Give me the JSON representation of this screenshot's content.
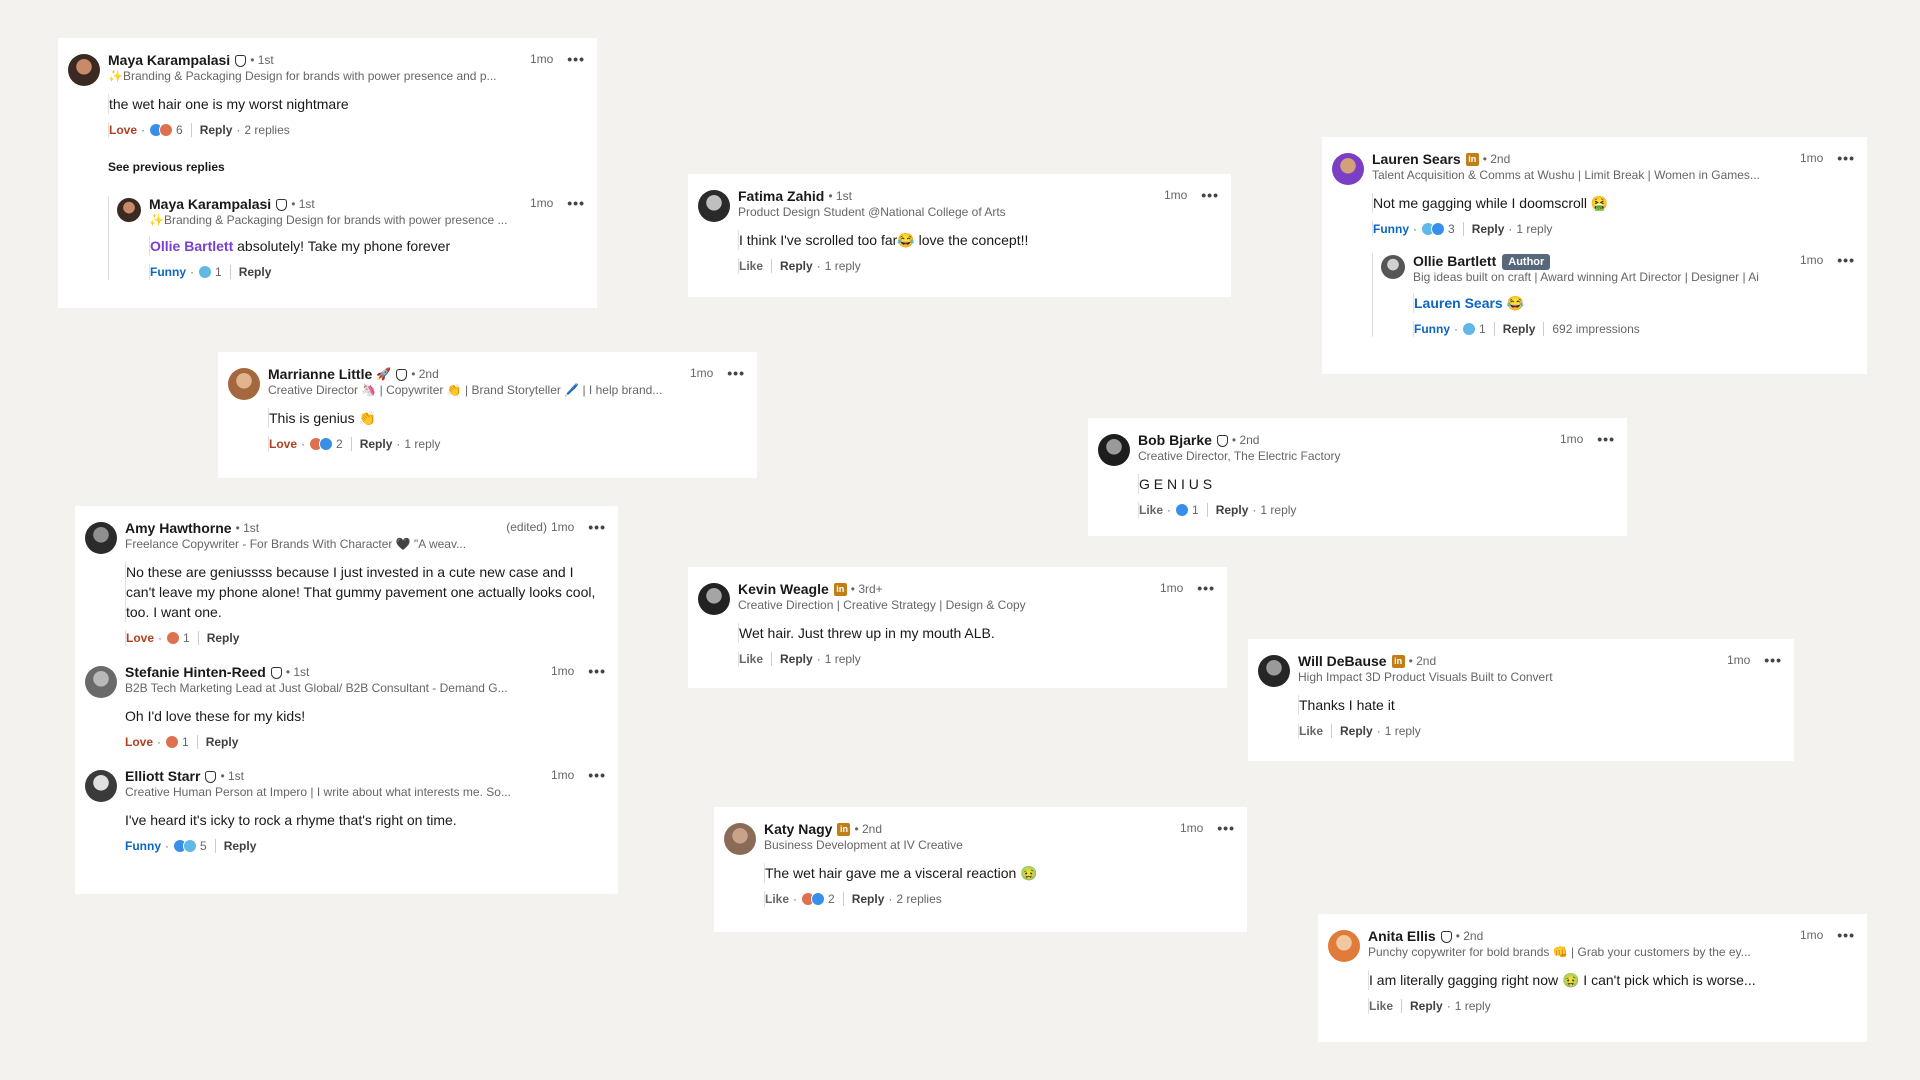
{
  "colors": {
    "background": "#f3f2ef",
    "love": "#b24020",
    "funny": "#0a66c2",
    "mention": "#0a66c2",
    "mention_alt": "#7a3fd0"
  },
  "cards": {
    "maya": {
      "name": "Maya Karampalasi",
      "degree": "• 1st",
      "time": "1mo",
      "headline": "✨Branding & Packaging Design for brands with power presence and p...",
      "text": "the wet hair one is my worst nightmare",
      "reaction": "Love",
      "count": "6",
      "reply": "Reply",
      "replies": "2 replies",
      "see_previous": "See previous replies",
      "child": {
        "name": "Maya Karampalasi",
        "degree": "• 1st",
        "time": "1mo",
        "headline": "✨Branding & Packaging Design for brands with power presence ...",
        "mention": "Ollie Bartlett",
        "text": " absolutely! Take my phone forever",
        "reaction": "Funny",
        "count": "1",
        "reply": "Reply"
      }
    },
    "fatima": {
      "name": "Fatima Zahid",
      "degree": "• 1st",
      "time": "1mo",
      "headline": "Product Design Student @National College of Arts",
      "text": "I think I've scrolled too far😂 love the concept!!",
      "reaction": "Like",
      "reply": "Reply",
      "replies": "1 reply"
    },
    "lauren": {
      "name": "Lauren Sears",
      "degree": "• 2nd",
      "time": "1mo",
      "headline": "Talent Acquisition & Comms at Wushu | Limit Break | Women in Games...",
      "text": "Not me gagging while I doomscroll 🤮",
      "reaction": "Funny",
      "count": "3",
      "reply": "Reply",
      "replies": "1 reply",
      "child": {
        "name": "Ollie Bartlett",
        "badge": "Author",
        "time": "1mo",
        "headline": "Big ideas built on craft | Award winning Art Director | Designer | Ai",
        "mention": "Lauren Sears",
        "text": " 😂",
        "reaction": "Funny",
        "count": "1",
        "reply": "Reply",
        "impressions": "692 impressions"
      }
    },
    "marrianne": {
      "name": "Marrianne Little",
      "emoji": "🚀",
      "degree": "• 2nd",
      "time": "1mo",
      "headline": "Creative Director 🦄 | Copywriter 👏 | Brand Storyteller 🖊️ | I help brand...",
      "text": "This is genius 👏",
      "reaction": "Love",
      "count": "2",
      "reply": "Reply",
      "replies": "1 reply"
    },
    "bob": {
      "name": "Bob Bjarke",
      "degree": "• 2nd",
      "time": "1mo",
      "headline": "Creative Director, The Electric Factory",
      "text": "G E N I U S",
      "reaction": "Like",
      "count": "1",
      "reply": "Reply",
      "replies": "1 reply"
    },
    "amy_group": {
      "amy": {
        "name": "Amy Hawthorne",
        "degree": "• 1st",
        "edited": "(edited)",
        "time": "1mo",
        "headline": "Freelance Copywriter - For Brands With Character 🖤 \"A weav...",
        "text": "No these are geniussss because I just invested in a cute new case and I can't leave my phone alone! That gummy pavement one actually looks cool, too. I want one.",
        "reaction": "Love",
        "count": "1",
        "reply": "Reply"
      },
      "stefanie": {
        "name": "Stefanie Hinten-Reed",
        "degree": "• 1st",
        "time": "1mo",
        "headline": "B2B Tech Marketing Lead at Just Global/ B2B Consultant - Demand G...",
        "text": "Oh I'd love these for my kids!",
        "reaction": "Love",
        "count": "1",
        "reply": "Reply"
      },
      "elliott": {
        "name": "Elliott Starr",
        "degree": "• 1st",
        "time": "1mo",
        "headline": "Creative Human Person at Impero | I write about what interests me. So...",
        "text": "I've heard it's icky to rock a rhyme that's right on time.",
        "reaction": "Funny",
        "count": "5",
        "reply": "Reply"
      }
    },
    "kevin": {
      "name": "Kevin Weagle",
      "degree": "• 3rd+",
      "time": "1mo",
      "headline": "Creative Direction | Creative Strategy | Design & Copy",
      "text": "Wet hair. Just threw up in my mouth ALB.",
      "reaction": "Like",
      "reply": "Reply",
      "replies": "1 reply"
    },
    "will": {
      "name": "Will DeBause",
      "degree": "• 2nd",
      "time": "1mo",
      "headline": "High Impact 3D Product Visuals Built to Convert",
      "text": "Thanks I hate it",
      "reaction": "Like",
      "reply": "Reply",
      "replies": "1 reply"
    },
    "katy": {
      "name": "Katy Nagy",
      "degree": "• 2nd",
      "time": "1mo",
      "headline": "Business Development at IV Creative",
      "text": "The wet hair gave me a visceral reaction 🤢",
      "reaction": "Like",
      "count": "2",
      "reply": "Reply",
      "replies": "2 replies"
    },
    "anita": {
      "name": "Anita Ellis",
      "degree": "• 2nd",
      "time": "1mo",
      "headline": "Punchy copywriter for bold brands 👊 | Grab your customers by the ey...",
      "text": "I am literally gagging right now 🤢 I can't pick which is worse...",
      "reaction": "Like",
      "reply": "Reply",
      "replies": "1 reply"
    }
  },
  "icons": {
    "more": "•••",
    "linkedin": "in"
  }
}
